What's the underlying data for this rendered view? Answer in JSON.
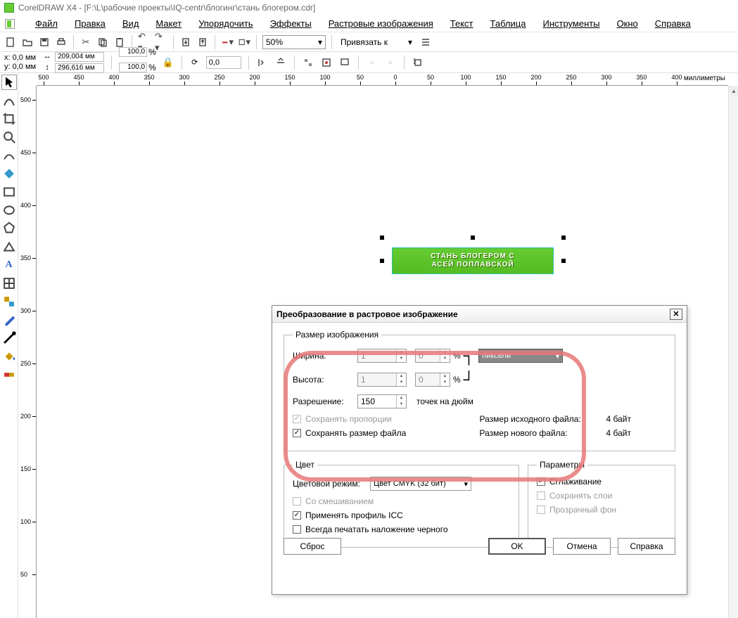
{
  "titlebar": {
    "text": "CorelDRAW X4 - [F:\\L\\рабочие проекты\\IQ-centr\\блогинг\\стань блогером.cdr]"
  },
  "menu": {
    "file": "Файл",
    "edit": "Правка",
    "view": "Вид",
    "layout": "Макет",
    "arrange": "Упорядочить",
    "effects": "Эффекты",
    "bitmaps": "Растровые изображения",
    "text": "Текст",
    "table": "Таблица",
    "tools": "Инструменты",
    "window": "Окно",
    "help": "Справка"
  },
  "toolbar": {
    "zoom": "50%",
    "snap": "Привязать к"
  },
  "propbar": {
    "x_lbl": "x:",
    "x_val": "0,0 мм",
    "y_lbl": "y:",
    "y_val": "0,0 мм",
    "w_val": "209,004 мм",
    "h_val": "296,616 мм",
    "pct1": "100,0",
    "pct2": "100,0",
    "pct_sym": "%",
    "rot": "0,0"
  },
  "ruler": {
    "units": "миллиметры",
    "h_ticks": [
      0,
      50,
      100,
      150,
      200,
      250,
      300,
      350,
      400,
      450,
      500
    ],
    "h_labels": [
      "500",
      "450",
      "400",
      "350",
      "300",
      "250",
      "200",
      "150",
      "100",
      "50",
      "0",
      "50",
      "100",
      "150",
      "200",
      "250",
      "300",
      "350",
      "400"
    ],
    "v_labels": [
      "500",
      "450",
      "400",
      "350",
      "300",
      "250",
      "200",
      "150",
      "100",
      "50"
    ]
  },
  "obj": {
    "line1": "СТАНЬ БЛОГЕРОМ С",
    "line2": "АСЕЙ ПОПЛАВСКОЙ"
  },
  "dialog": {
    "title": "Преобразование в растровое изображение",
    "fs_image": "Размер изображения",
    "width_lbl": "Ширина:",
    "width_val": "1",
    "width_pct": "0",
    "height_lbl": "Высота:",
    "height_val": "1",
    "height_pct": "0",
    "pct": "%",
    "res_lbl": "Разрешение:",
    "res_val": "150",
    "dpi": "точек на дюйм",
    "units": "пиксели",
    "keep_ratio": "Сохранять пропорции",
    "keep_size": "Сохранять размер файла",
    "src_size_lbl": "Размер исходного файла:",
    "src_size_val": "4 байт",
    "new_size_lbl": "Размер нового файла:",
    "new_size_val": "4 байт",
    "fs_color": "Цвет",
    "color_mode_lbl": "Цветовой режим:",
    "color_mode_val": "Цвет CMYK (32 бит)",
    "dither": "Со смешиванием",
    "icc": "Применять профиль ICC",
    "blackoverprint": "Всегда печатать наложение черного",
    "fs_params": "Параметры",
    "antialias": "Сглаживание",
    "layers": "Сохранять слои",
    "transparent": "Прозрачный фон",
    "btn_reset": "Сброс",
    "btn_ok": "OK",
    "btn_cancel": "Отмена",
    "btn_help": "Справка"
  }
}
